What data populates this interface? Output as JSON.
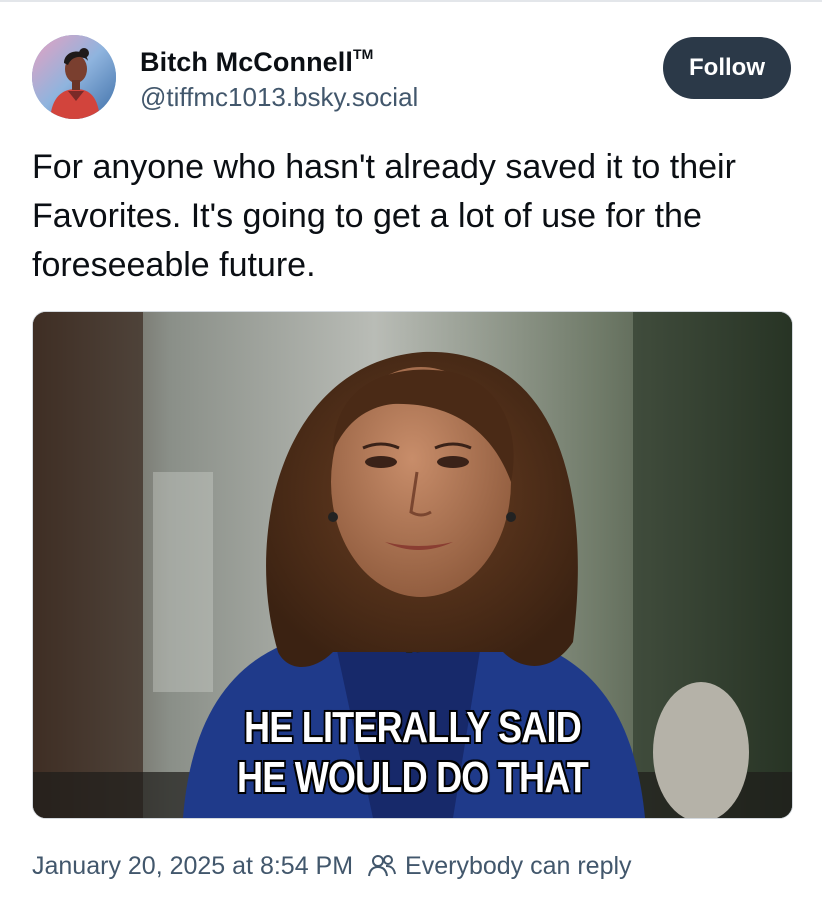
{
  "author": {
    "display_name": "Bitch McConnell",
    "display_name_mark": "TM",
    "handle": "@tiffmc1013.bsky.social"
  },
  "actions": {
    "follow_label": "Follow"
  },
  "post": {
    "text": "For anyone who hasn't already saved it to their Favorites. It's going to get a lot of use for the foreseeable future.",
    "image": {
      "caption_line1": "HE LITERALLY SAID",
      "caption_line2": "HE WOULD DO THAT"
    }
  },
  "meta": {
    "timestamp": "January 20, 2025 at 8:54 PM",
    "reply_setting": "Everybody can reply",
    "reply_icon": "people-icon"
  },
  "colors": {
    "follow_button_bg": "#2b3948",
    "secondary_text": "#42576c",
    "primary_text": "#0b0f14"
  }
}
